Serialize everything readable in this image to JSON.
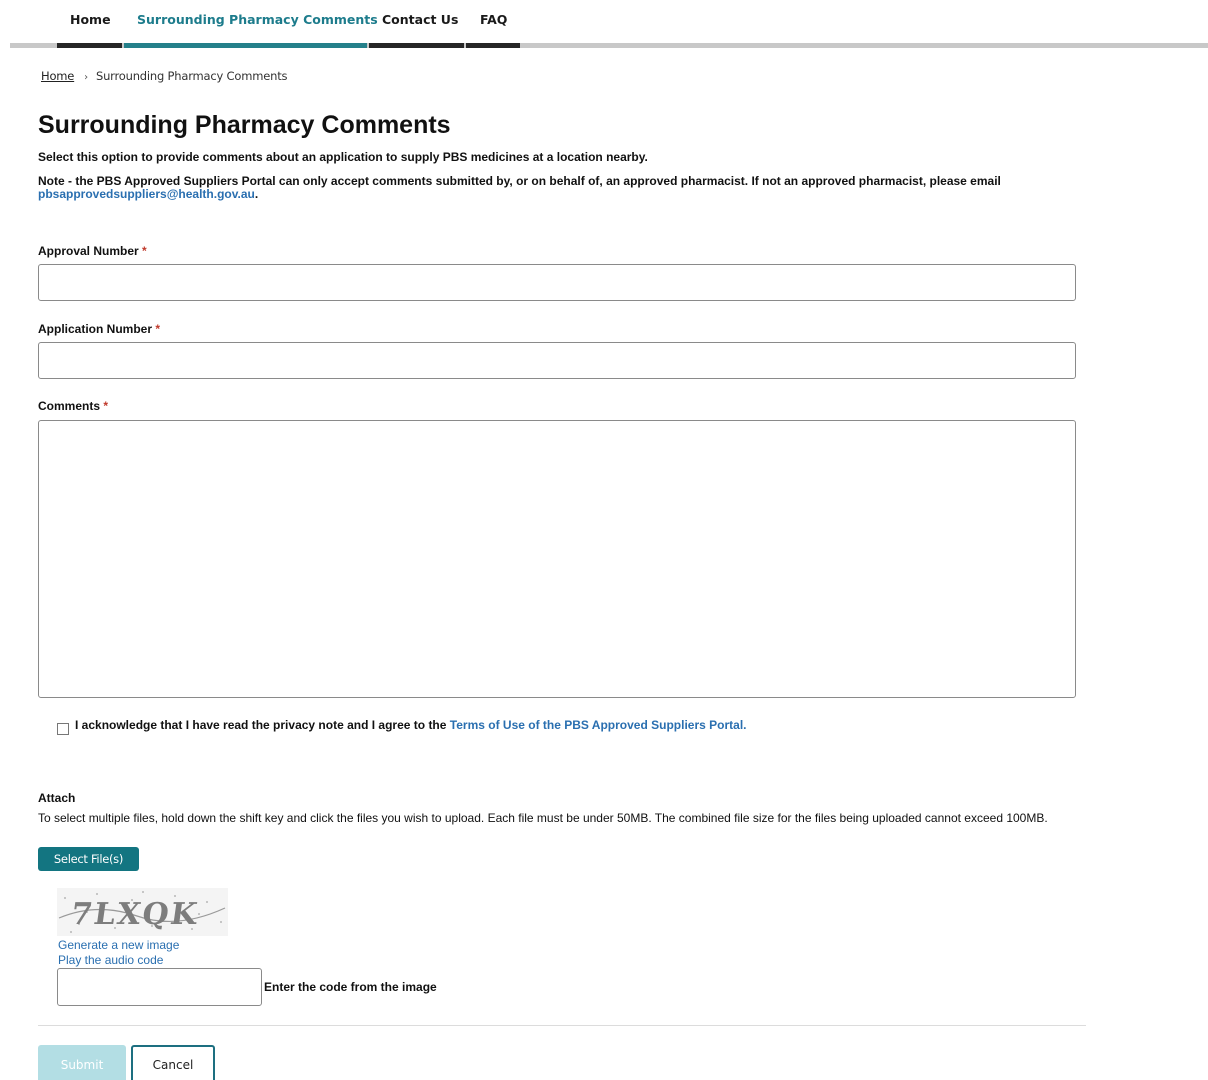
{
  "nav": {
    "items": [
      {
        "label": "Home"
      },
      {
        "label": "Surrounding Pharmacy Comments"
      },
      {
        "label": "Contact Us"
      },
      {
        "label": "FAQ"
      }
    ],
    "colors": {
      "active": "#1d7c8c",
      "bar_active": "#24808a",
      "bar": "#262626",
      "track": "#c8c8c8"
    }
  },
  "breadcrumb": {
    "home": "Home",
    "separator": "›",
    "current": "Surrounding Pharmacy Comments"
  },
  "page": {
    "title": "Surrounding Pharmacy Comments",
    "intro": "Select this option to provide comments about an application to supply PBS medicines at a location nearby.",
    "note_text": "Note - the PBS Approved Suppliers Portal can only accept comments submitted by, or on behalf of, an approved pharmacist. If not an approved pharmacist, please email",
    "note_email": "pbsapprovedsuppliers@health.gov.au",
    "note_end": "."
  },
  "form": {
    "required_marker": "*",
    "approval_number": {
      "label": "Approval Number",
      "value": "",
      "placeholder": ""
    },
    "application_number": {
      "label": "Application Number",
      "value": "",
      "placeholder": ""
    },
    "comments": {
      "label": "Comments",
      "value": "",
      "placeholder": ""
    },
    "acknowledge": {
      "checked": false,
      "text": "I acknowledge that I have read the privacy note and I agree to the",
      "link": "Terms of Use of the PBS Approved Suppliers Portal."
    },
    "attach": {
      "title": "Attach",
      "help": "To select multiple files, hold down the shift key and click the files you wish to upload. Each file must be under 50MB. The combined file size for the files being uploaded cannot exceed 100MB.",
      "button": "Select File(s)"
    },
    "captcha": {
      "image_text": "7LXQK",
      "generate_link": "Generate a new image",
      "audio_link": "Play the audio code",
      "input_value": "",
      "input_label": "Enter the code from the image"
    },
    "submit_label": "Submit",
    "cancel_label": "Cancel"
  },
  "colors": {
    "accent": "#137581",
    "link": "#2a6fb0",
    "submit_disabled": "#b3dee4",
    "required": "#c0392b"
  }
}
